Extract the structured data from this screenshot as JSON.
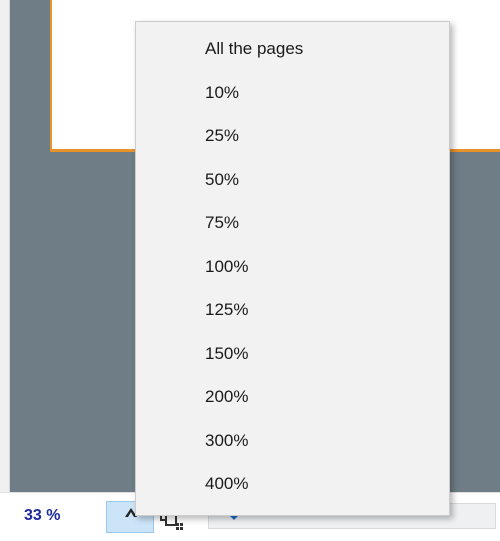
{
  "zoom_menu": {
    "items": [
      "All the pages",
      "10%",
      "25%",
      "50%",
      "75%",
      "100%",
      "125%",
      "150%",
      "200%",
      "300%",
      "400%"
    ]
  },
  "statusbar": {
    "zoom_label": "33 %",
    "zoom_level": 0.33
  },
  "icons": {
    "menu_toggle": "chevron-up-icon",
    "page_layout": "page-layout-icon",
    "slider_thumb": "slider-thumb-icon"
  },
  "colors": {
    "workspace": "#6e7d86",
    "page_border": "#e8922c",
    "zoom_text": "#1c2a9c",
    "toggle_bg": "#cce4f7",
    "menu_bg": "#f2f2f2",
    "slider_thumb": "#1f6fd1"
  }
}
